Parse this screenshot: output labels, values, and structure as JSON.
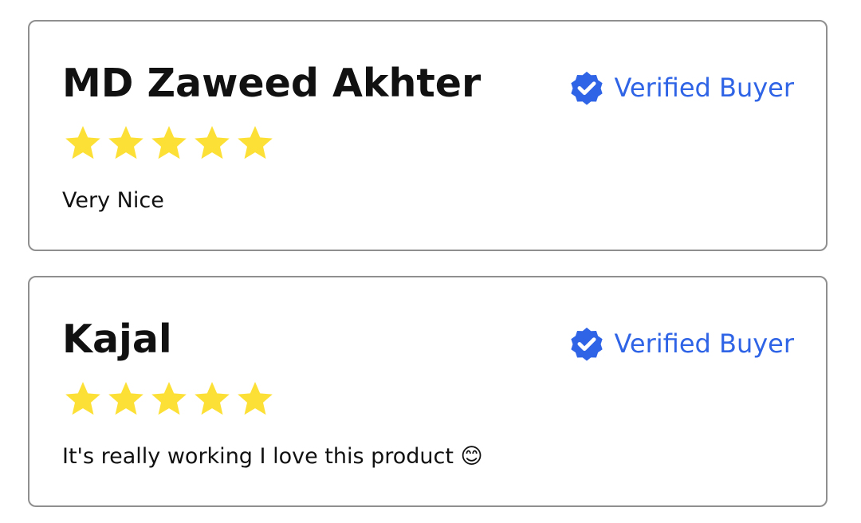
{
  "colors": {
    "accent": "#2f64e6",
    "star": "#fde036",
    "border": "#8f8f8f",
    "text": "#111111"
  },
  "reviews": [
    {
      "name": "MD Zaweed Akhter",
      "badge": "Verified Buyer",
      "badge_icon": "verified-badge-icon",
      "rating": 5,
      "rating_max": 5,
      "text": "Very Nice"
    },
    {
      "name": "Kajal",
      "badge": "Verified Buyer",
      "badge_icon": "verified-badge-icon",
      "rating": 5,
      "rating_max": 5,
      "text": "It's really working I love this product 😊"
    }
  ]
}
